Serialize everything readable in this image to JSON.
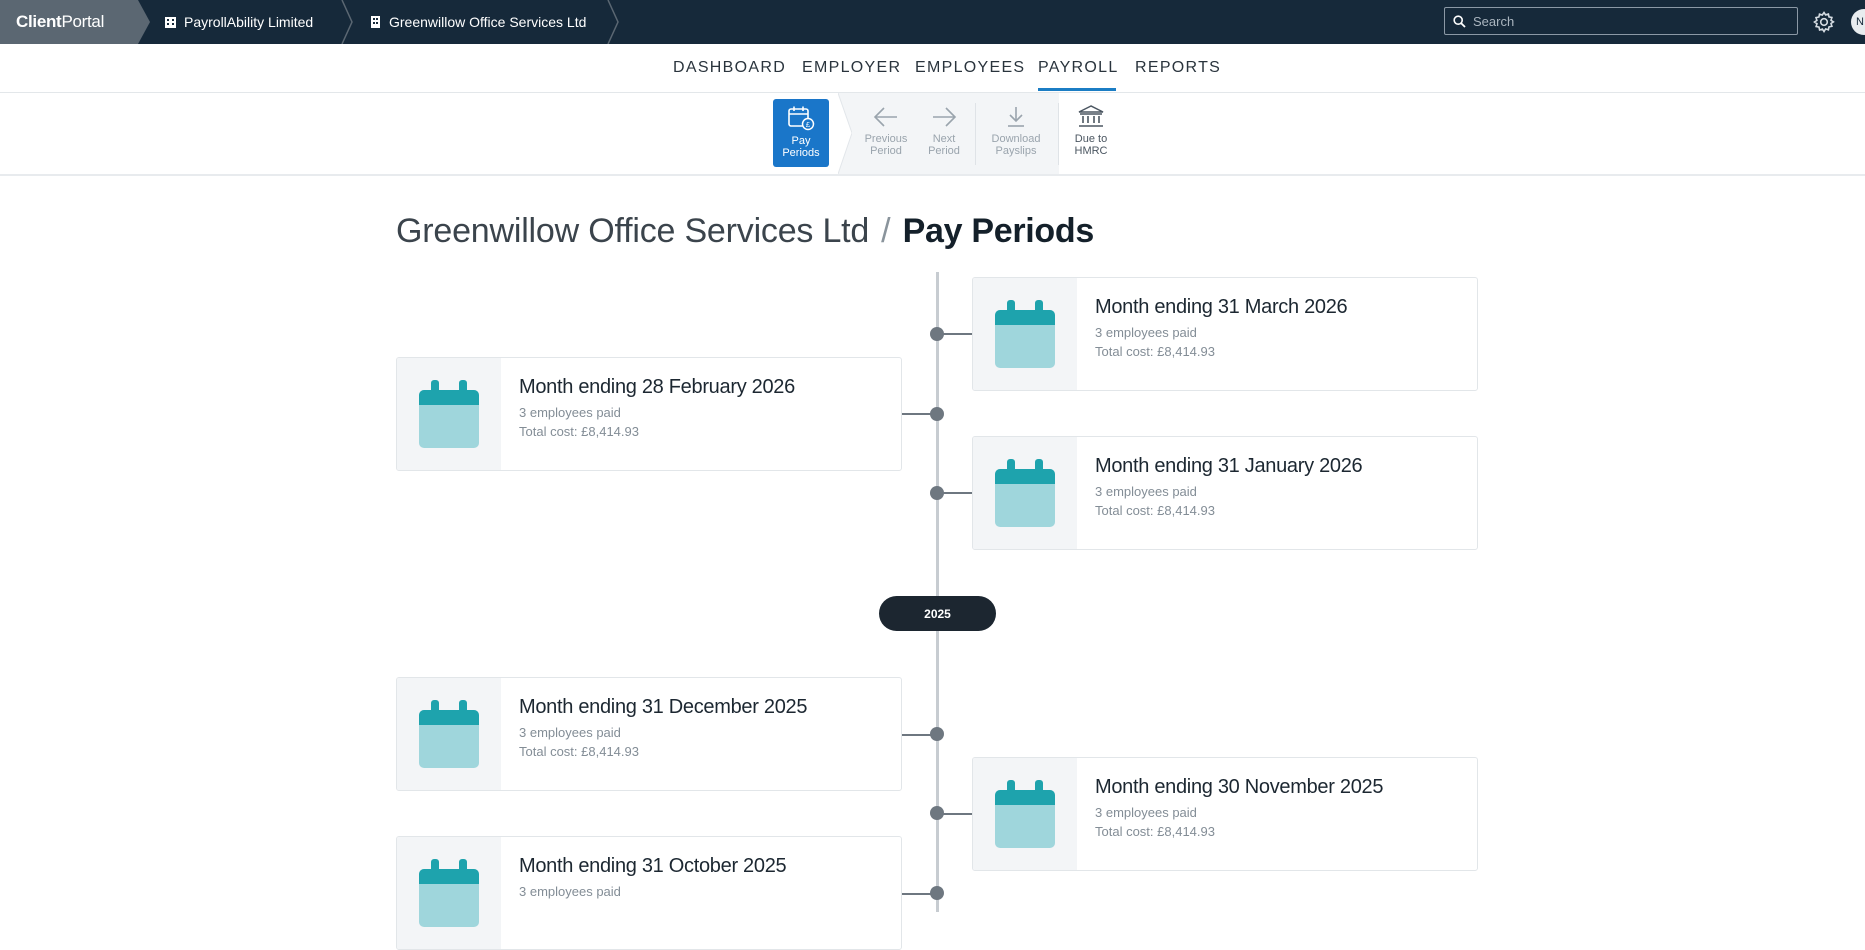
{
  "topbar": {
    "portal_bold": "Client",
    "portal_light": "Portal",
    "breadcrumbs": [
      "PayrollAbility Limited",
      "Greenwillow Office Services Ltd"
    ],
    "search_placeholder": "Search",
    "avatar_initials": "N"
  },
  "nav": {
    "tabs": [
      "DASHBOARD",
      "EMPLOYER",
      "EMPLOYEES",
      "PAYROLL",
      "REPORTS"
    ],
    "active": "PAYROLL"
  },
  "toolbar": {
    "pay_periods": [
      "Pay",
      "Periods"
    ],
    "previous_period": [
      "Previous",
      "Period"
    ],
    "next_period": [
      "Next",
      "Period"
    ],
    "download_payslips": [
      "Download",
      "Payslips"
    ],
    "due_to_hmrc": [
      "Due to",
      "HMRC"
    ]
  },
  "heading": {
    "company": "Greenwillow Office Services Ltd",
    "separator": "/",
    "title": "Pay Periods"
  },
  "timeline": {
    "year_marker": "2025",
    "periods": [
      {
        "title": "Month ending 31 March 2026",
        "employees": "3 employees paid",
        "cost": "Total cost: £8,414.93"
      },
      {
        "title": "Month ending 28 February 2026",
        "employees": "3 employees paid",
        "cost": "Total cost: £8,414.93"
      },
      {
        "title": "Month ending 31 January 2026",
        "employees": "3 employees paid",
        "cost": "Total cost: £8,414.93"
      },
      {
        "title": "Month ending 31 December 2025",
        "employees": "3 employees paid",
        "cost": "Total cost: £8,414.93"
      },
      {
        "title": "Month ending 30 November 2025",
        "employees": "3 employees paid",
        "cost": "Total cost: £8,414.93"
      },
      {
        "title": "Month ending 31 October 2025",
        "employees": "3 employees paid",
        "cost": ""
      }
    ]
  },
  "colors": {
    "topbar_bg": "#16293a",
    "accent_blue": "#1a76c9",
    "calendar_top": "#1ea3ad",
    "calendar_body": "#9fd6dc"
  }
}
